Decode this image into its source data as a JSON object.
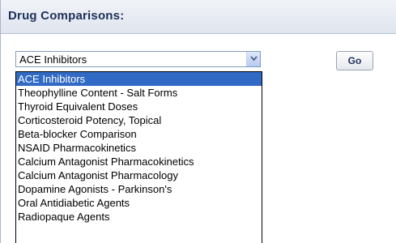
{
  "header": {
    "title": "Drug Comparisons:"
  },
  "select": {
    "value": "ACE Inhibitors"
  },
  "go_button": {
    "label": "Go"
  },
  "dropdown": {
    "selected_index": 0,
    "options": [
      "ACE Inhibitors",
      "Theophylline Content - Salt Forms",
      "Thyroid Equivalent Doses",
      "Corticosteroid Potency, Topical",
      "Beta-blocker Comparison",
      "NSAID Pharmacokinetics",
      "Calcium Antagonist Pharmacokinetics",
      "Calcium Antagonist Pharmacology",
      "Dopamine Agonists - Parkinson's",
      "Oral Antidiabetic Agents",
      "Radiopaque Agents"
    ]
  },
  "colors": {
    "header_text": "#1f2f5b",
    "selection_bg": "#316ac5",
    "selection_text": "#ffffff"
  }
}
